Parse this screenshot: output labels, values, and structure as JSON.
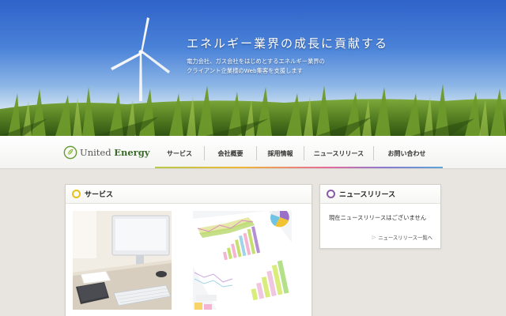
{
  "hero": {
    "headline": "エネルギー業界の成長に貢献する",
    "sub_line1": "電力会社、ガス会社をはじめとするエネルギー業界の",
    "sub_line2": "クライアント企業様のWeb集客を支援します"
  },
  "logo": {
    "text_light": "United",
    "text_bold": "Energy",
    "icon": "leaf-logo-icon"
  },
  "nav": {
    "items": [
      {
        "label": "サービス"
      },
      {
        "label": "会社概要"
      },
      {
        "label": "採用情報"
      },
      {
        "label": "ニュースリリース"
      },
      {
        "label": "お問い合わせ"
      }
    ]
  },
  "services": {
    "title": "サービス",
    "icon": "yellow-ring-icon",
    "images": [
      "desk-computer-photo",
      "report-charts-photo"
    ]
  },
  "news": {
    "title": "ニュースリリース",
    "icon": "purple-ring-icon",
    "empty_text": "現在ニュースリリースはございません",
    "list_link": "ニュースリリース一覧へ"
  },
  "colors": {
    "accent_yellow": "#e8c21a",
    "accent_purple": "#8a5aa8",
    "background": "#e8e5e0"
  }
}
